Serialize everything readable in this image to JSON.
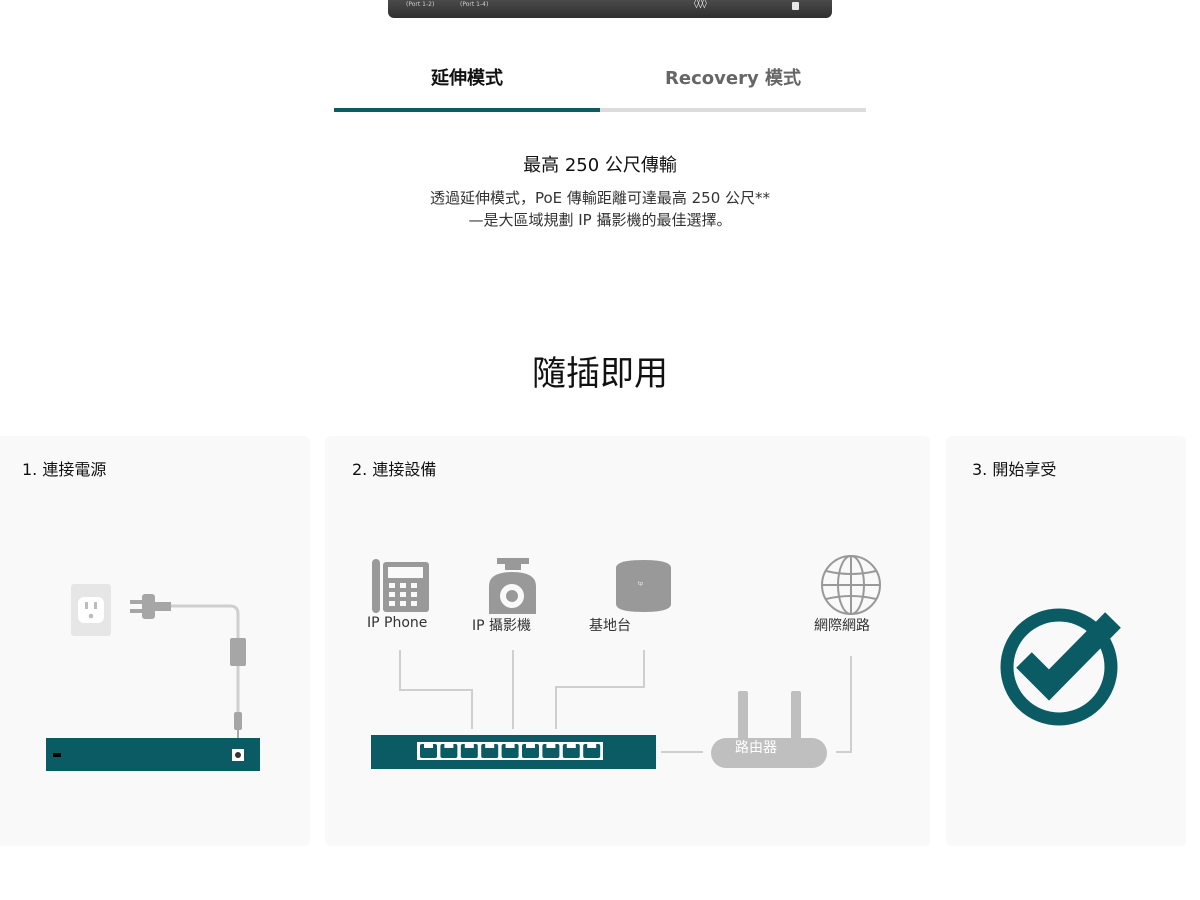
{
  "device_strip": {
    "port_label_1": "(Port 1-2)",
    "port_label_2": "(Port 1-4)"
  },
  "tabs": [
    {
      "label": "延伸模式",
      "active": true
    },
    {
      "label": "Recovery 模式",
      "active": false
    }
  ],
  "extend_mode": {
    "heading": "最高 250 公尺傳輸",
    "line1": "透過延伸模式，PoE 傳輸距離可達最高 250 公尺**",
    "line2": "—是大區域規劃 IP 攝影機的最佳選擇。"
  },
  "plug_and_play": {
    "title": "隨插即用",
    "steps": [
      {
        "label": "1. 連接電源"
      },
      {
        "label": "2. 連接設備"
      },
      {
        "label": "3. 開始享受"
      }
    ],
    "devices": [
      "IP Phone",
      "IP 攝影機",
      "基地台",
      "網際網路"
    ],
    "router_label": "路由器",
    "switch_port_count": 9,
    "icons": [
      "power-outlet-icon",
      "power-plug-icon",
      "ip-phone-icon",
      "ip-camera-icon",
      "access-point-icon",
      "globe-icon",
      "router-icon",
      "checkmark-circle-icon"
    ]
  },
  "colors": {
    "accent": "#0a5b64",
    "tab_inactive": "#dcdcdc",
    "icon_gray": "#999999",
    "card_bg": "#f9f9f9"
  }
}
